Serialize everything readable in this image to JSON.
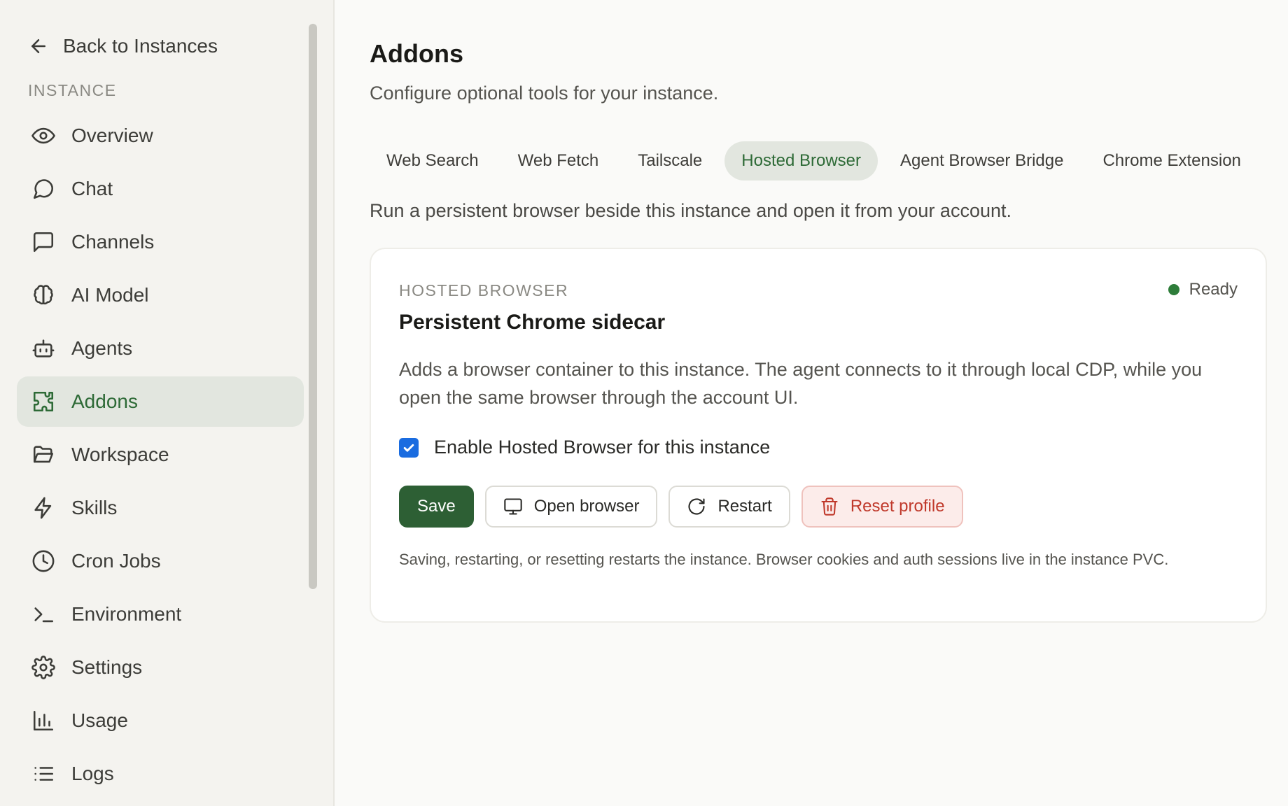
{
  "sidebar": {
    "back_label": "Back to Instances",
    "section_label": "INSTANCE",
    "items": [
      {
        "label": "Overview",
        "icon": "eye-icon"
      },
      {
        "label": "Chat",
        "icon": "chat-icon"
      },
      {
        "label": "Channels",
        "icon": "message-square-icon"
      },
      {
        "label": "AI Model",
        "icon": "brain-icon"
      },
      {
        "label": "Agents",
        "icon": "bot-icon"
      },
      {
        "label": "Addons",
        "icon": "puzzle-icon",
        "active": true
      },
      {
        "label": "Workspace",
        "icon": "folder-icon"
      },
      {
        "label": "Skills",
        "icon": "lightning-icon"
      },
      {
        "label": "Cron Jobs",
        "icon": "clock-icon"
      },
      {
        "label": "Environment",
        "icon": "terminal-icon"
      },
      {
        "label": "Settings",
        "icon": "gear-icon"
      },
      {
        "label": "Usage",
        "icon": "bar-chart-icon"
      },
      {
        "label": "Logs",
        "icon": "list-icon"
      }
    ]
  },
  "main": {
    "title": "Addons",
    "subtitle": "Configure optional tools for your instance.",
    "tabs": [
      {
        "label": "Web Search"
      },
      {
        "label": "Web Fetch"
      },
      {
        "label": "Tailscale"
      },
      {
        "label": "Hosted Browser",
        "active": true
      },
      {
        "label": "Agent Browser Bridge"
      },
      {
        "label": "Chrome Extension"
      }
    ],
    "tab_description": "Run a persistent browser beside this instance and open it from your account.",
    "card": {
      "eyebrow": "HOSTED BROWSER",
      "status": "Ready",
      "status_color": "#2e7d3a",
      "title": "Persistent Chrome sidecar",
      "description": "Adds a browser container to this instance. The agent connects to it through local CDP, while you open the same browser through the account UI.",
      "checkbox_label": "Enable Hosted Browser for this instance",
      "checkbox_checked": true,
      "buttons": {
        "save": "Save",
        "open_browser": "Open browser",
        "restart": "Restart",
        "reset_profile": "Reset profile"
      },
      "note": "Saving, restarting, or resetting restarts the instance. Browser cookies and auth sessions live in the instance PVC."
    }
  },
  "colors": {
    "accent": "#2d6a36",
    "primary_button": "#2d5f34",
    "danger": "#c0392b",
    "checkbox": "#1a6ce0"
  }
}
